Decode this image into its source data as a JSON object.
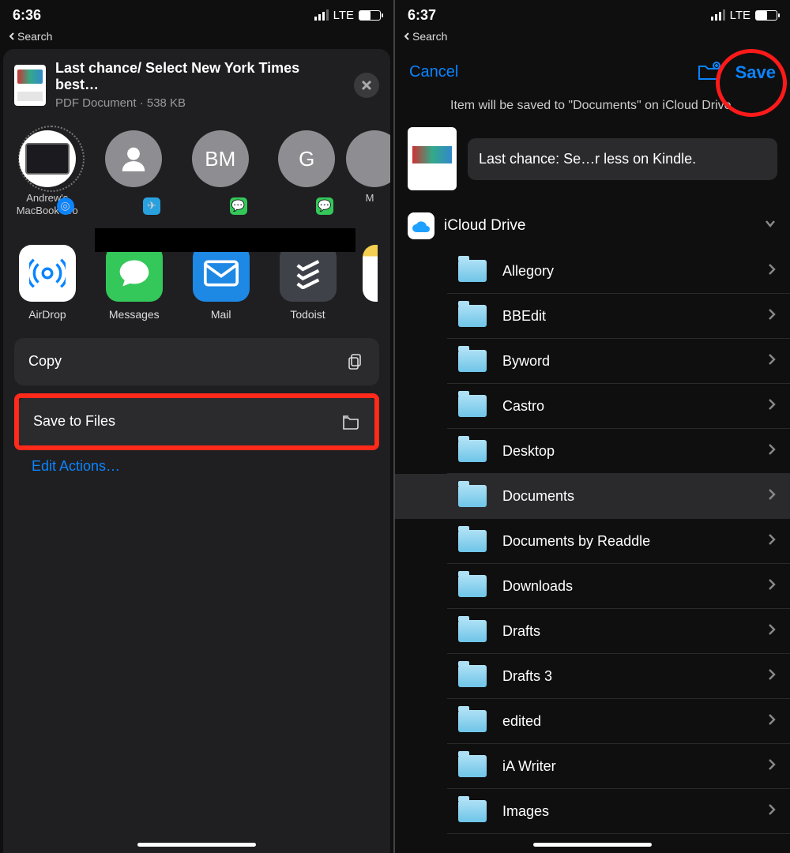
{
  "left": {
    "status_time": "6:36",
    "network": "LTE",
    "back_search": "Search",
    "doc": {
      "title": "Last chance/ Select New York Times best…",
      "subtitle": "PDF Document · 538 KB"
    },
    "contacts": [
      {
        "label": "Andrew's MacBook Pro",
        "avatar": "mac",
        "badge": "airdrop"
      },
      {
        "label": "",
        "avatar": "person",
        "badge": "telegram"
      },
      {
        "label": "",
        "avatar": "BM",
        "badge": "msg"
      },
      {
        "label": "",
        "avatar": "G",
        "badge": "msg"
      },
      {
        "label": "M",
        "avatar": "partial",
        "badge": ""
      }
    ],
    "apps": [
      {
        "label": "AirDrop"
      },
      {
        "label": "Messages"
      },
      {
        "label": "Mail"
      },
      {
        "label": "Todoist"
      },
      {
        "label": ""
      }
    ],
    "actions": {
      "copy": "Copy",
      "save_files": "Save to Files"
    },
    "edit_actions": "Edit Actions…"
  },
  "right": {
    "status_time": "6:37",
    "network": "LTE",
    "back_search": "Search",
    "cancel": "Cancel",
    "save": "Save",
    "save_msg": "Item will be saved to \"Documents\" on iCloud Drive.",
    "file_name": "Last chance: Se…r less on Kindle.",
    "location": "iCloud Drive",
    "folders": [
      "Allegory",
      "BBEdit",
      "Byword",
      "Castro",
      "Desktop",
      "Documents",
      "Documents by Readdle",
      "Downloads",
      "Drafts",
      "Drafts 3",
      "edited",
      "iA Writer",
      "Images"
    ],
    "selected_folder": "Documents"
  }
}
